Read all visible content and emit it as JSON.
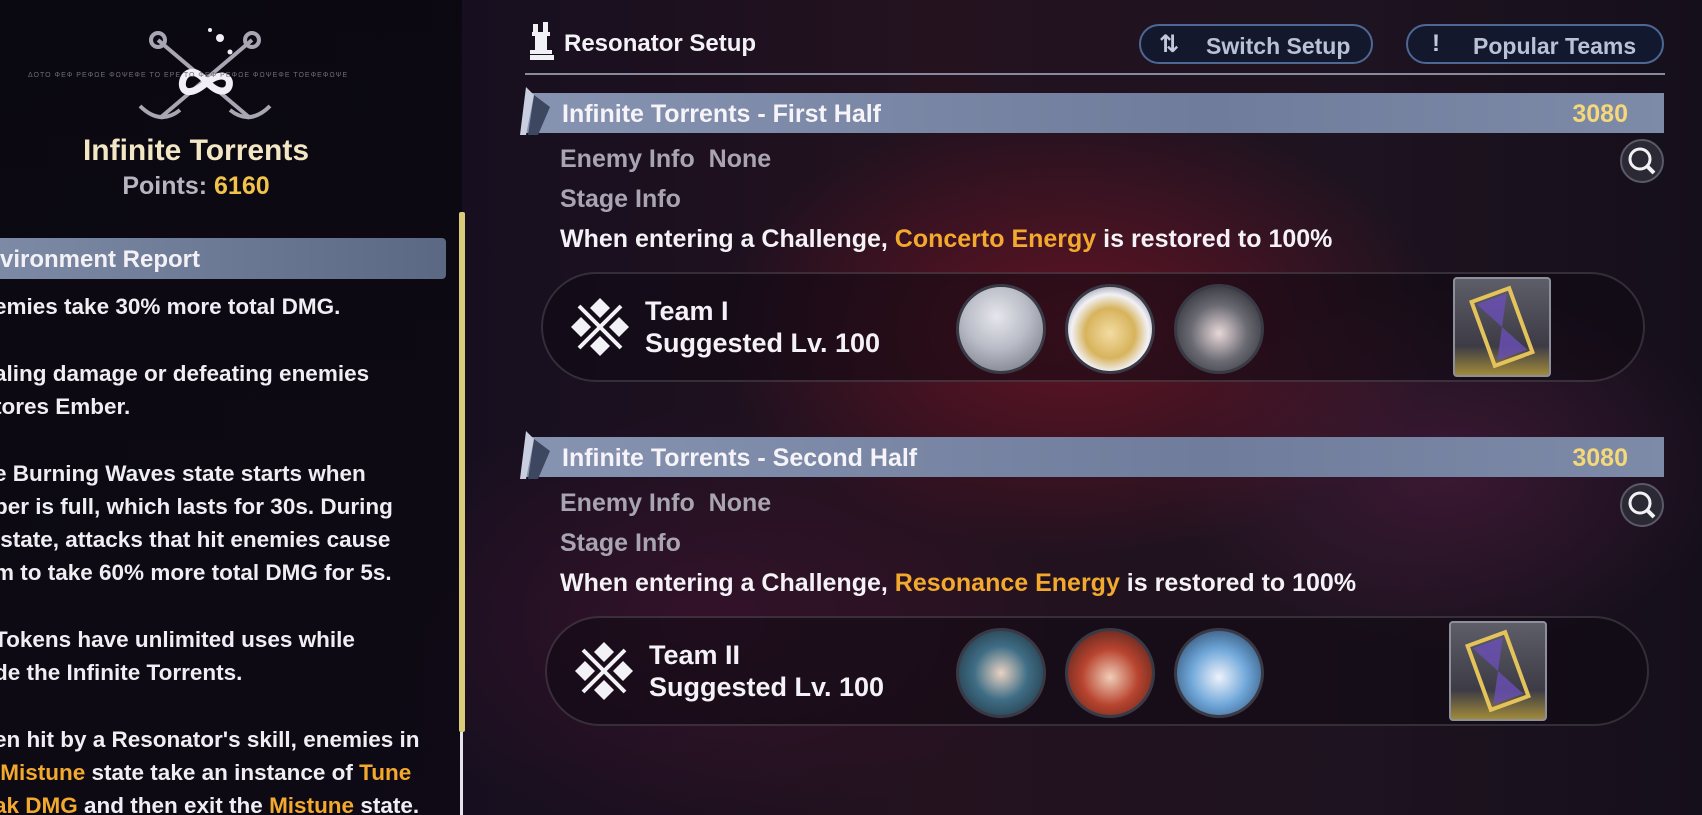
{
  "sidebar": {
    "emblem_text": "ΔΟΤΟ ΦΕΦ ΡΕΦΩΕ  ΦΩΨΕΦΕ ΤΟ  ΕΡΕ  ΤΟ ΦΕΦ ΡΕΦΩΕ  ΦΩΨΕΦΕ ΤΟΕΦΕΦΩΨΕ",
    "event_title": "Infinite Torrents",
    "points_label": "Points:",
    "points_value": "6160",
    "env_header": "vironment Report",
    "env_lines": {
      "p1": "emies take 30% more total DMG.",
      "p2a": "aling damage or defeating enemies",
      "p2b": "tores Ember.",
      "p3a": "e Burning Waves state starts when",
      "p3b": "ber is full, which lasts for 30s. During",
      "p3c": " state, attacks that hit enemies cause",
      "p3d": "m to take 60% more total DMG for 5s.",
      "p4a": "Tokens have unlimited uses while",
      "p4b": "de the Infinite Torrents.",
      "p5a": "en hit by a Resonator's skill, enemies in",
      "p5b_1": " ",
      "p5b_hl1": "Mistune",
      "p5b_2": " state take an instance of ",
      "p5b_hl2": "Tune",
      "p5c_hl1": "ak DMG",
      "p5c_2": " and then exit the ",
      "p5c_hl2": "Mistune",
      "p5c_3": " state."
    }
  },
  "header": {
    "title": "Resonator Setup",
    "switch_setup_label": "Switch Setup",
    "switch_setup_icon": "swap-vertical-icon",
    "popular_teams_label": "Popular Teams",
    "popular_teams_icon": "exclamation-icon"
  },
  "stages": [
    {
      "title": "Infinite Torrents - First Half",
      "points": "3080",
      "enemy_info_label": "Enemy Info",
      "enemy_info_value": "None",
      "stage_info_label": "Stage Info",
      "condition_pre": "When entering a Challenge, ",
      "condition_hl": "Concerto Energy",
      "condition_post": " is restored to 100%",
      "team_name": "Team I",
      "team_level": "Suggested Lv. 100"
    },
    {
      "title": "Infinite Torrents - Second Half",
      "points": "3080",
      "enemy_info_label": "Enemy Info",
      "enemy_info_value": "None",
      "stage_info_label": "Stage Info",
      "condition_pre": "When entering a Challenge, ",
      "condition_hl": "Resonance Energy",
      "condition_post": " is restored to 100%",
      "team_name": "Team II",
      "team_level": "Suggested Lv. 100"
    }
  ],
  "colors": {
    "accent_gold": "#f2c24a",
    "highlight_orange": "#f2a92e",
    "stage_header": "#7d8aa8",
    "button_border": "#4e6795"
  }
}
